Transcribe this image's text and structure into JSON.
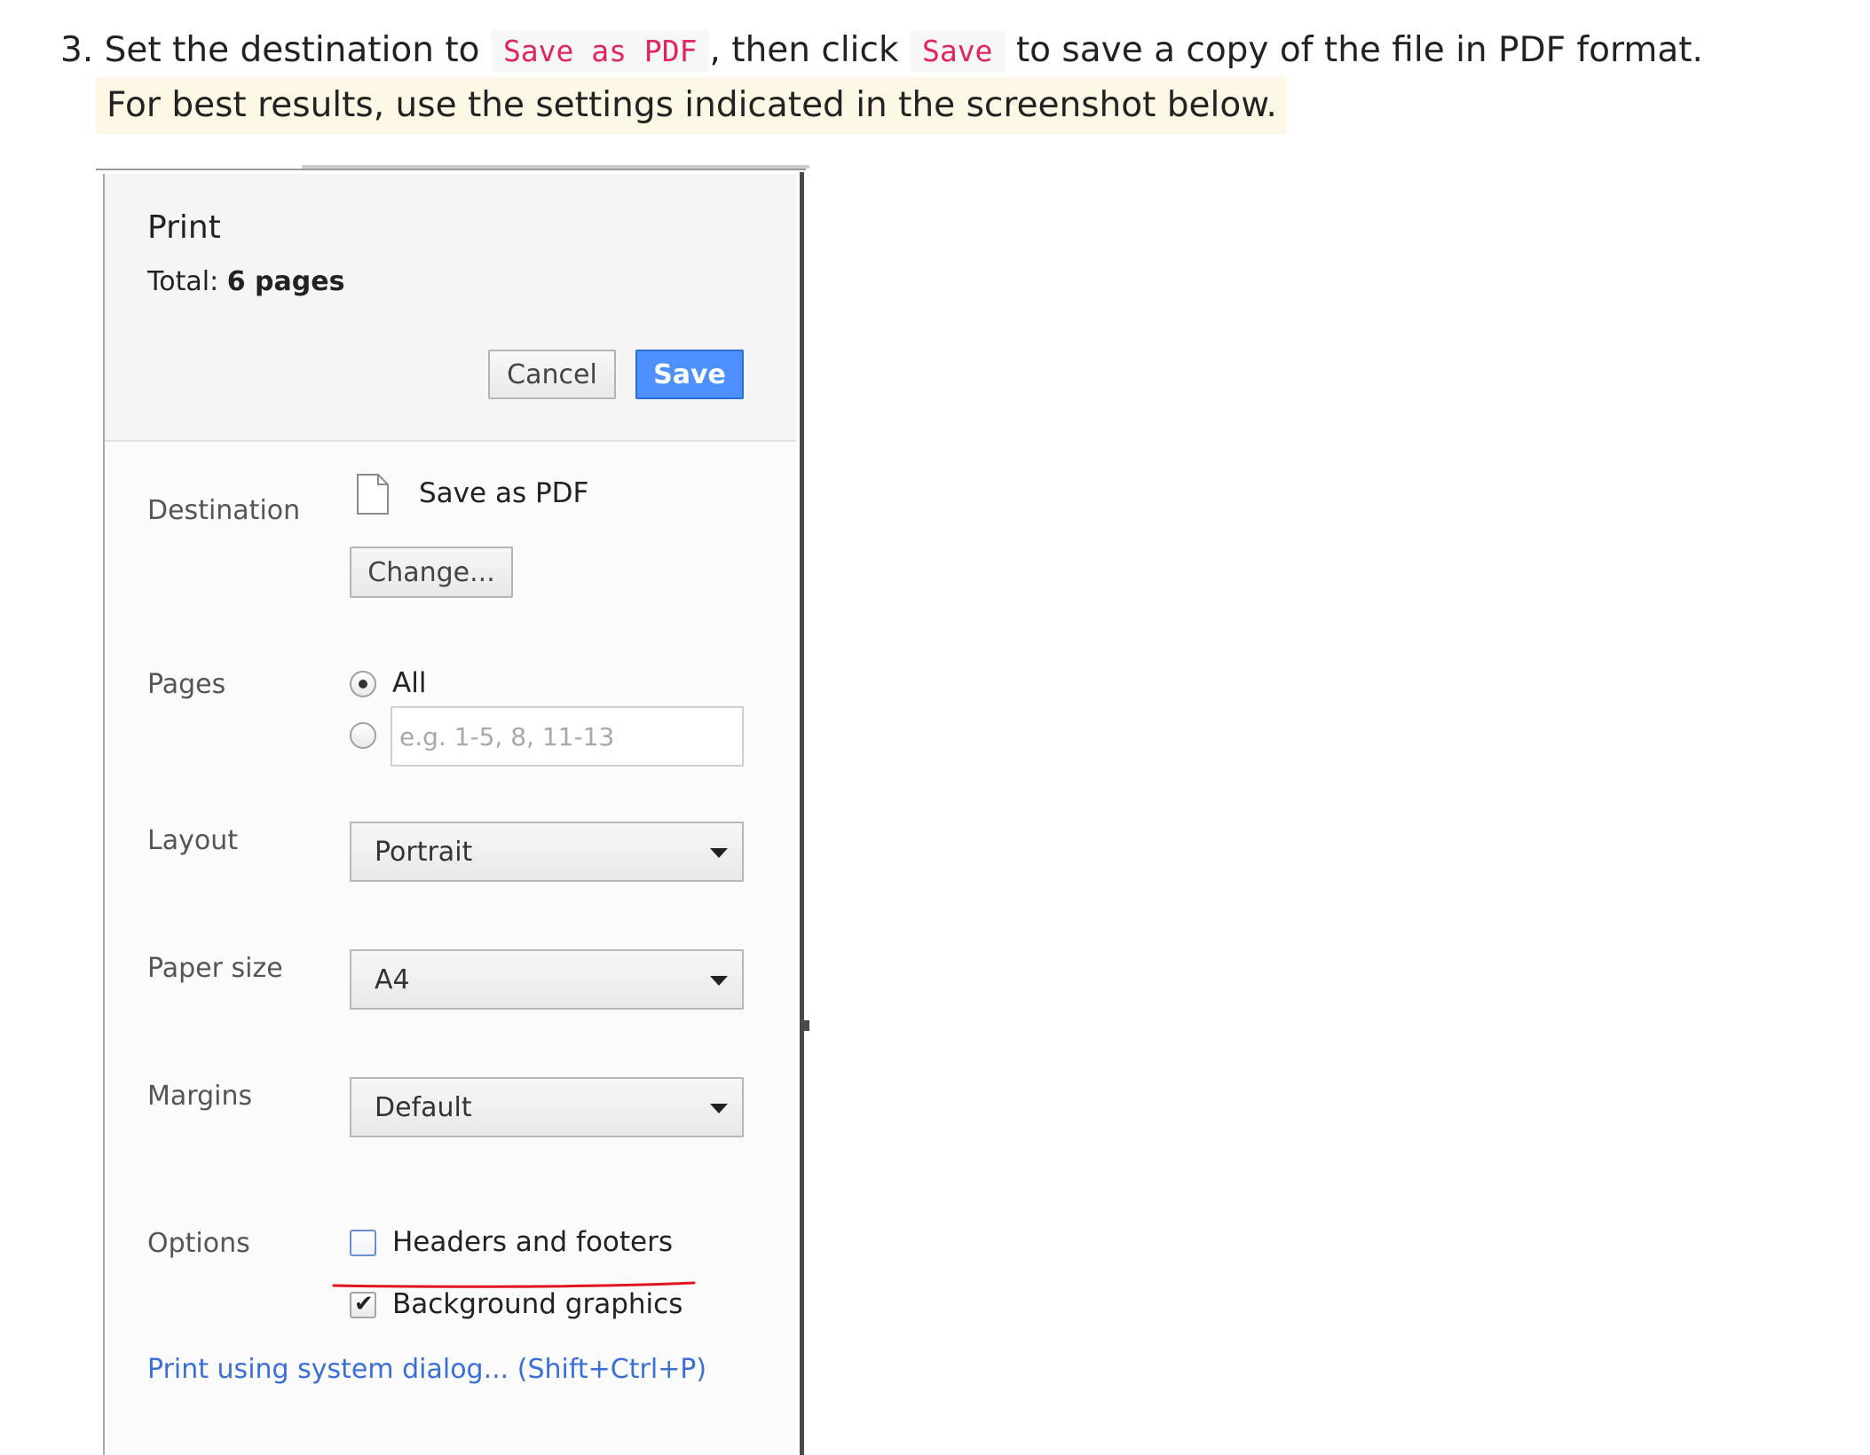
{
  "instruction": {
    "step_number": "3.",
    "text_1": "Set the destination to",
    "code_1": "Save as PDF",
    "text_2": ", then click",
    "code_2": "Save",
    "text_3": "to save a copy of the file in PDF format.",
    "note": "For best results, use the settings indicated in the screenshot below."
  },
  "dialog": {
    "title": "Print",
    "total_label": "Total:",
    "total_value": "6 pages",
    "cancel_label": "Cancel",
    "save_label": "Save",
    "destination": {
      "label": "Destination",
      "value": "Save as PDF",
      "change_label": "Change..."
    },
    "pages": {
      "label": "Pages",
      "all_label": "All",
      "all_selected": true,
      "range_placeholder": "e.g. 1-5, 8, 11-13"
    },
    "layout": {
      "label": "Layout",
      "value": "Portrait"
    },
    "paper_size": {
      "label": "Paper size",
      "value": "A4"
    },
    "margins": {
      "label": "Margins",
      "value": "Default"
    },
    "options": {
      "label": "Options",
      "headers_footers_label": "Headers and footers",
      "headers_footers_checked": false,
      "background_graphics_label": "Background graphics",
      "background_graphics_checked": true
    },
    "system_dialog_link": "Print using system dialog... (Shift+Ctrl+P)"
  },
  "colors": {
    "code_text": "#e0245e",
    "note_highlight": "#fdf8e6",
    "save_button": "#4d90fe",
    "link": "#3a6fd8",
    "annotation_underline": "#e0141e"
  },
  "icons": [
    "document-icon",
    "chevron-down-icon",
    "checkmark-icon"
  ]
}
